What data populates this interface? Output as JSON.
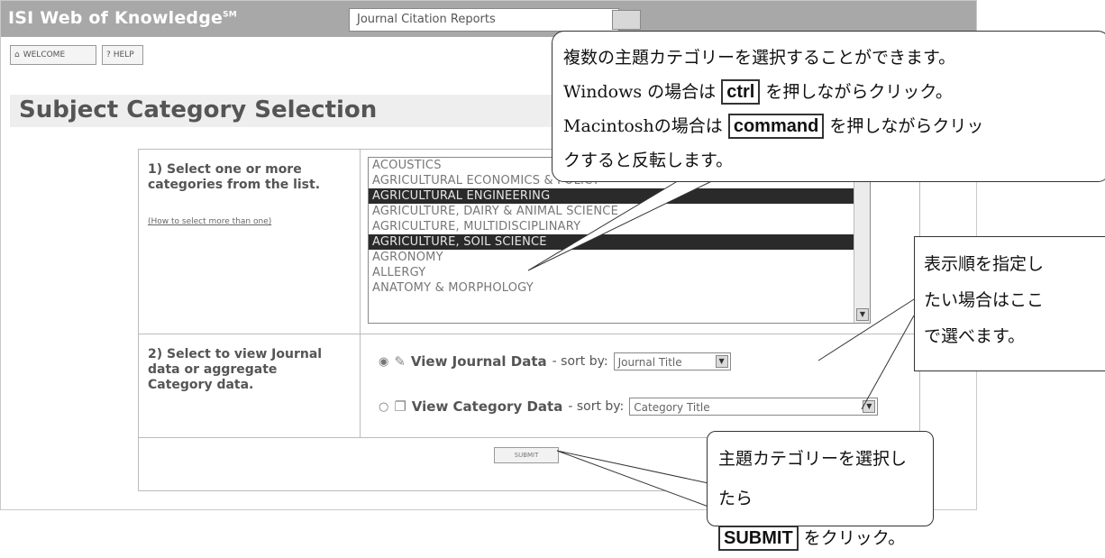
{
  "header": {
    "brand": "ISI Web of Knowledge",
    "brand_tm": "SM",
    "database_select": "Journal Citation Reports"
  },
  "toolbar": {
    "welcome_label": "WELCOME",
    "help_label": "HELP"
  },
  "page": {
    "title": "Subject Category Selection"
  },
  "step1": {
    "label": "1) Select one or more categories from the list.",
    "help_link": "(How to select more than one)",
    "options": [
      {
        "label": "ACOUSTICS",
        "selected": false
      },
      {
        "label": "AGRICULTURAL ECONOMICS & POLICY",
        "selected": false
      },
      {
        "label": "AGRICULTURAL ENGINEERING",
        "selected": true
      },
      {
        "label": "AGRICULTURE, DAIRY & ANIMAL SCIENCE",
        "selected": false
      },
      {
        "label": "AGRICULTURE, MULTIDISCIPLINARY",
        "selected": false
      },
      {
        "label": "AGRICULTURE, SOIL SCIENCE",
        "selected": true
      },
      {
        "label": "AGRONOMY",
        "selected": false
      },
      {
        "label": "ALLERGY",
        "selected": false
      },
      {
        "label": "ANATOMY & MORPHOLOGY",
        "selected": false
      }
    ]
  },
  "step2": {
    "label": "2) Select to view Journal data or aggregate Category data.",
    "journal": {
      "label": "View Journal Data",
      "sort_prefix": " - sort by:",
      "sort_value": "Journal Title",
      "checked": true
    },
    "category": {
      "label": "View Category Data",
      "sort_prefix": " - sort by:",
      "sort_value": "Category Title",
      "checked": false
    }
  },
  "submit_label": "SUBMIT",
  "callouts": {
    "multi": {
      "line1": "複数の主題カテゴリーを選択することができます。",
      "line2_pre": "Windows の場合は ",
      "line2_key": "ctrl",
      "line2_post": " を押しながらクリック。",
      "line3_pre": "Macintoshの場合は ",
      "line3_key": "command",
      "line3_post": " を押しながらクリッ",
      "line4": "クすると反転します。"
    },
    "sort": {
      "line1": "表示順を指定し",
      "line2": "たい場合はここ",
      "line3": "で選べます。"
    },
    "submit": {
      "line1": "主題カテゴリーを選択したら",
      "line2_key": "SUBMIT",
      "line2_post": " をクリック。"
    }
  }
}
